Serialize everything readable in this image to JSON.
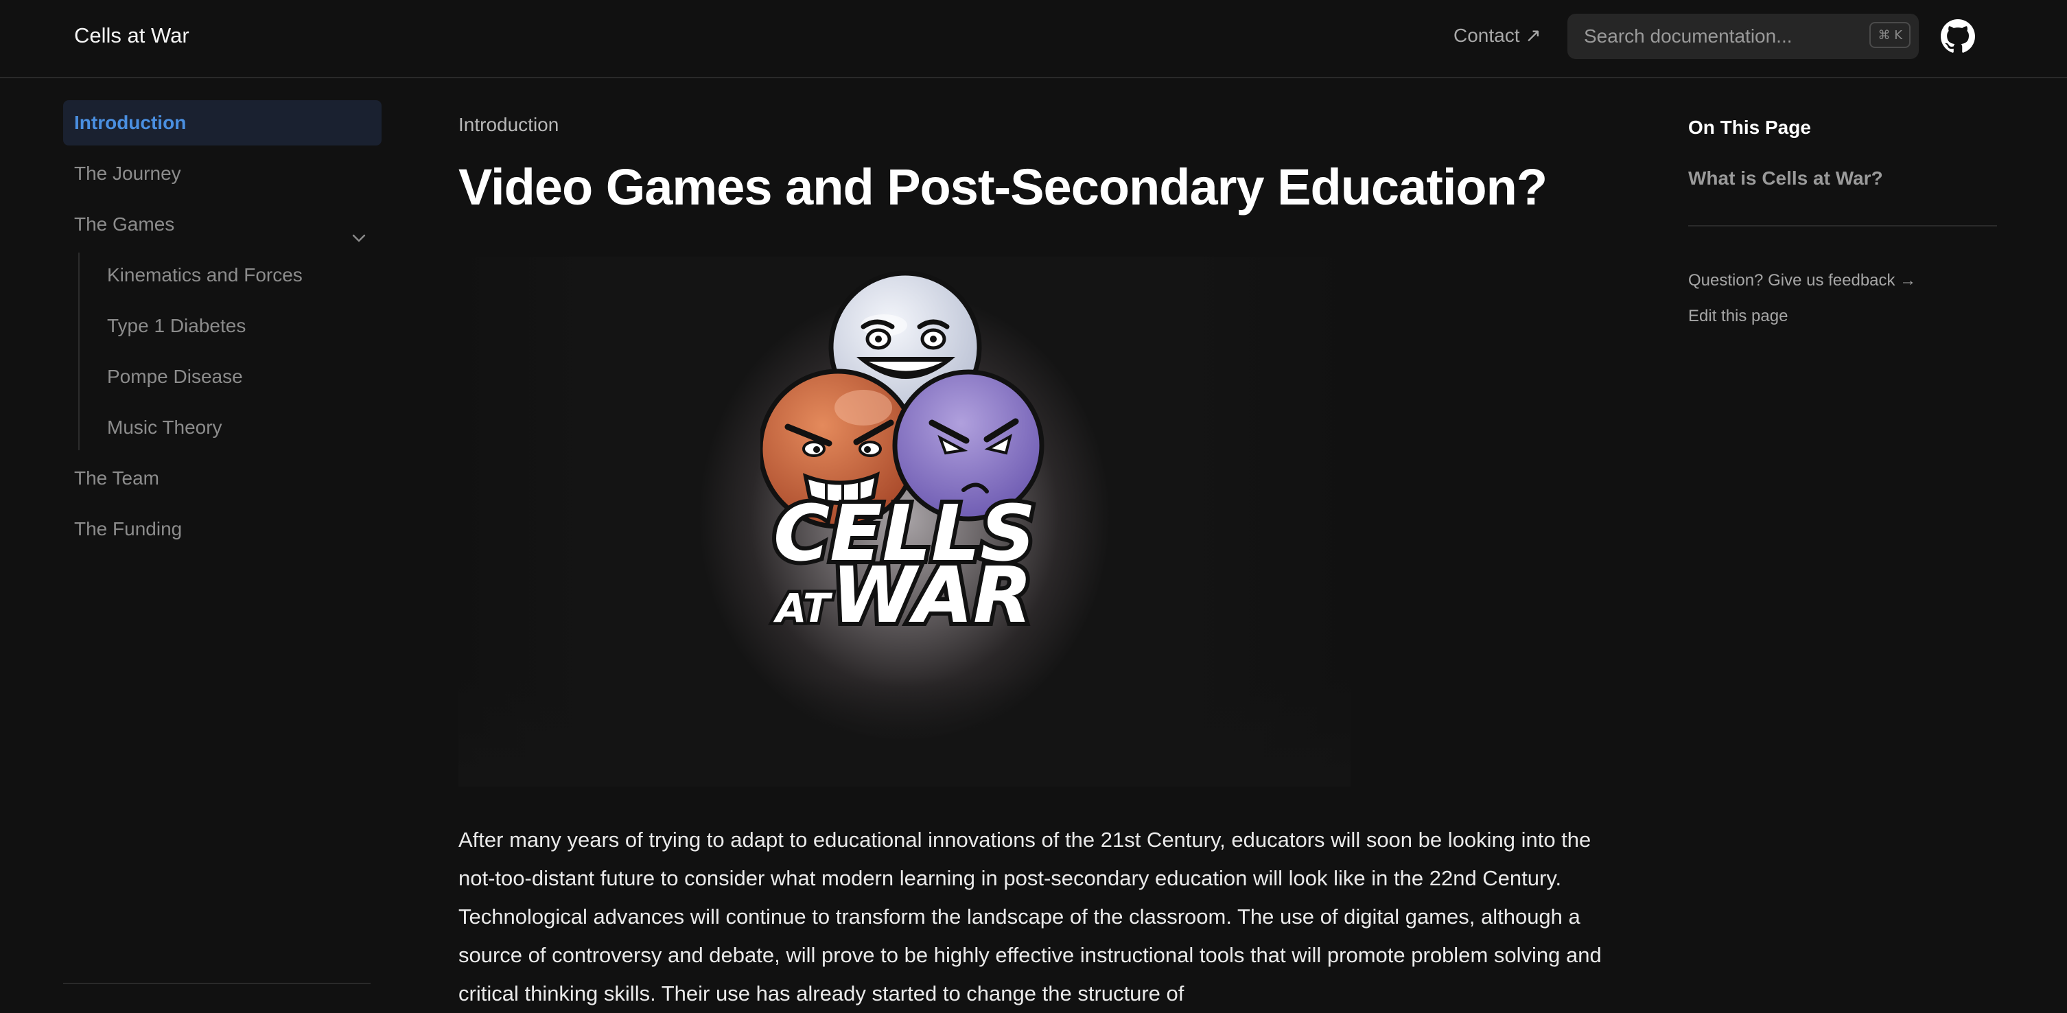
{
  "header": {
    "site_title": "Cells at War",
    "contact_label": "Contact ↗",
    "search_placeholder": "Search documentation...",
    "search_shortcut": "⌘ K",
    "github_icon": "github-icon"
  },
  "sidebar": {
    "items": [
      {
        "label": "Introduction",
        "active": true
      },
      {
        "label": "The Journey"
      },
      {
        "label": "The Games",
        "expanded": true,
        "icon": "chevron-down-icon"
      },
      {
        "label": "The Team"
      },
      {
        "label": "The Funding"
      }
    ],
    "games_children": [
      {
        "label": "Kinematics and Forces"
      },
      {
        "label": "Type 1 Diabetes"
      },
      {
        "label": "Pompe Disease"
      },
      {
        "label": "Music Theory"
      }
    ]
  },
  "main": {
    "breadcrumb": "Introduction",
    "title": "Video Games and Post-Secondary Education?",
    "hero_logo_text": "CELLS AT WAR",
    "paragraph": "After many years of trying to adapt to educational innovations of the 21st Century, educators will soon be looking into the not-too-distant future to consider what modern learning in post-secondary education will look like in the 22nd Century. Technological advances will continue to transform the landscape of the classroom. The use of digital games, although a source of controversy and debate, will prove to be highly effective instructional tools that will promote problem solving and critical thinking skills. Their use has already started to change the structure of"
  },
  "toc": {
    "heading": "On This Page",
    "links": [
      {
        "label": "What is Cells at War?"
      }
    ],
    "feedback_label": "Question? Give us feedback →",
    "edit_label": "Edit this page"
  },
  "colors": {
    "background": "#111111",
    "accent": "#4a8fe0",
    "active_bg": "#1a2130"
  }
}
